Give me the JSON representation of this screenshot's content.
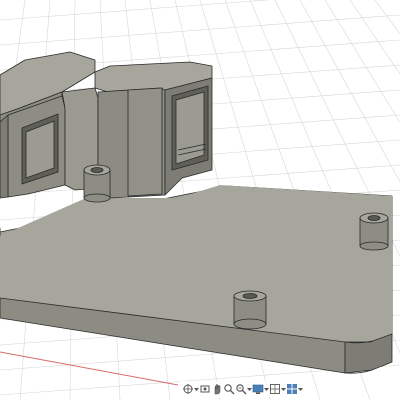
{
  "viewport": {
    "background": "#ffffff",
    "grid_color": "#d4d4d4",
    "axis_color": "#d96a6a",
    "model_colors": {
      "top_face": "#a3a39a",
      "front_face": "#8b8b82",
      "side_face": "#7a7a72",
      "dark_inner": "#5f5f58",
      "edge": "#2a2a2a"
    }
  },
  "nav_toolbar": {
    "items": [
      {
        "name": "orbit-icon"
      },
      {
        "name": "look-at-icon"
      },
      {
        "name": "pan-icon"
      },
      {
        "name": "zoom-icon"
      },
      {
        "name": "fit-icon"
      },
      {
        "name": "display-settings-icon"
      },
      {
        "name": "grid-settings-icon"
      },
      {
        "name": "viewports-icon"
      }
    ]
  }
}
